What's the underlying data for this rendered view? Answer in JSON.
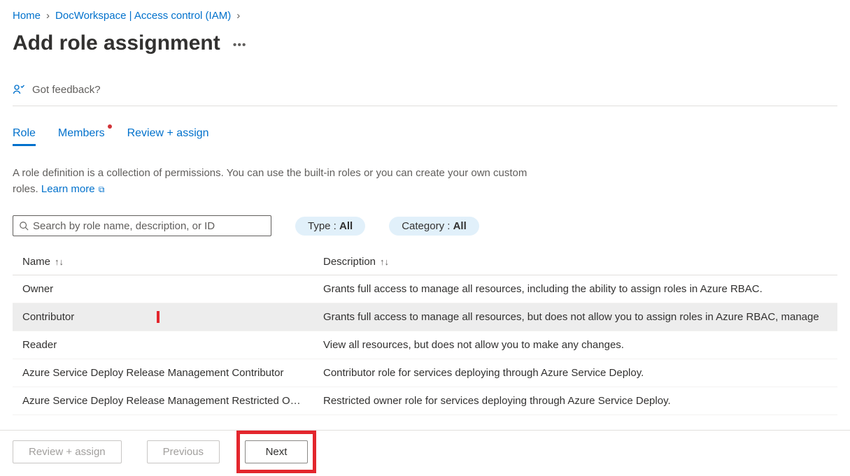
{
  "breadcrumb": {
    "home": "Home",
    "workspace": "DocWorkspace | Access control (IAM)"
  },
  "page": {
    "title": "Add role assignment"
  },
  "feedback": {
    "label": "Got feedback?"
  },
  "tabs": {
    "role": "Role",
    "members": "Members",
    "review": "Review + assign"
  },
  "description": {
    "text": "A role definition is a collection of permissions. You can use the built-in roles or you can create your own custom roles. ",
    "learn_more": "Learn more"
  },
  "search": {
    "placeholder": "Search by role name, description, or ID"
  },
  "filters": {
    "type_label": "Type : ",
    "type_value": "All",
    "category_label": "Category : ",
    "category_value": "All"
  },
  "columns": {
    "name": "Name",
    "description": "Description"
  },
  "roles": [
    {
      "name": "Owner",
      "desc": "Grants full access to manage all resources, including the ability to assign roles in Azure RBAC.",
      "highlight": false
    },
    {
      "name": "Contributor",
      "desc": "Grants full access to manage all resources, but does not allow you to assign roles in Azure RBAC, manage",
      "highlight": true
    },
    {
      "name": "Reader",
      "desc": "View all resources, but does not allow you to make any changes.",
      "highlight": false
    },
    {
      "name": "Azure Service Deploy Release Management Contributor",
      "desc": "Contributor role for services deploying through Azure Service Deploy.",
      "highlight": false
    },
    {
      "name": "Azure Service Deploy Release Management Restricted O…",
      "desc": "Restricted owner role for services deploying through Azure Service Deploy.",
      "highlight": false
    }
  ],
  "footer": {
    "review": "Review + assign",
    "previous": "Previous",
    "next": "Next"
  }
}
